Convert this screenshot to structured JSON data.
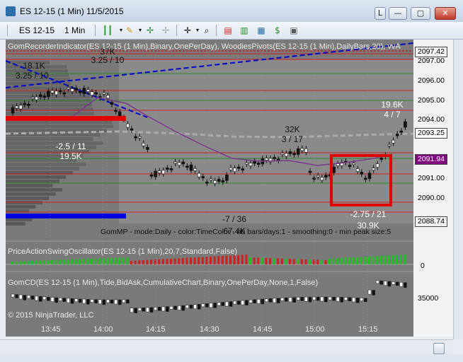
{
  "window": {
    "title": "ES 12-15 (1 Min)  11/5/2015",
    "buttons": [
      "L",
      "—",
      "▢",
      "✕"
    ]
  },
  "toolbar": {
    "instrument": "ES 12-15",
    "interval": "1 Min"
  },
  "panels": {
    "price_indicator": "GomRecorderIndicator(ES 12-15 (1 Min),Binary,OnePerDay), WoodiesPivots(ES 12-15 (1 Min),DailyBars,20), vvA",
    "gommp": "GomMP - mode:Daily - color:TimeColor - nb bars/days:1 - smoothing:0 - min peak size:5",
    "swing": "PriceActionSwingOscillator(ES 12-15 (1 Min),20,7,Standard,False)",
    "gomcd": "GomCD(ES 12-15 (1 Min),Tide,BidAsk,CumulativeChart,Binary,OnePerDay,None,1,False)",
    "copyright": "© 2015 NinjaTrader, LLC"
  },
  "swing_labels": [
    {
      "vol": "18.1K",
      "ratio": "3.25 / 10"
    },
    {
      "vol": "37K",
      "ratio": "3.25 / 10"
    },
    {
      "vol": "19.5K",
      "ratio": "-2.5 / 11"
    },
    {
      "vol": "32K",
      "ratio": "3 / 17"
    },
    {
      "vol": "67.4K",
      "ratio": "-7 / 36"
    },
    {
      "vol": "19.6K",
      "ratio": "4 / 7"
    },
    {
      "vol": "30.9K",
      "ratio": "-2.75 / 21"
    }
  ],
  "price_axis": {
    "ticks": [
      "2097.00",
      "2096.00",
      "2095.00",
      "2094.00",
      "2091.00",
      "2090.00"
    ],
    "tags": [
      {
        "text": "2097.42",
        "bg": "#f2f2f2",
        "fg": "#000000"
      },
      {
        "text": "2093.25",
        "bg": "#ffffff",
        "fg": "#000000"
      },
      {
        "text": "2091.94",
        "bg": "#800080",
        "fg": "#ffffff"
      },
      {
        "text": "2088.74",
        "bg": "#f2f2f2",
        "fg": "#000000"
      }
    ]
  },
  "swing_axis": {
    "zero": "0"
  },
  "cd_axis": {
    "tick": "35000"
  },
  "time_axis": [
    "13:45",
    "14:00",
    "14:15",
    "14:30",
    "14:45",
    "15:00",
    "15:15"
  ],
  "colors": {
    "chart_bg": "#7a7a7a",
    "highlight": "#e00000",
    "blue_line": "#0000cc",
    "ma_line": "#7a3a8a",
    "pivot_red": "#d02020",
    "pivot_green": "#2a8a2a",
    "osc_up": "#22c022",
    "osc_down": "#d02020"
  }
}
